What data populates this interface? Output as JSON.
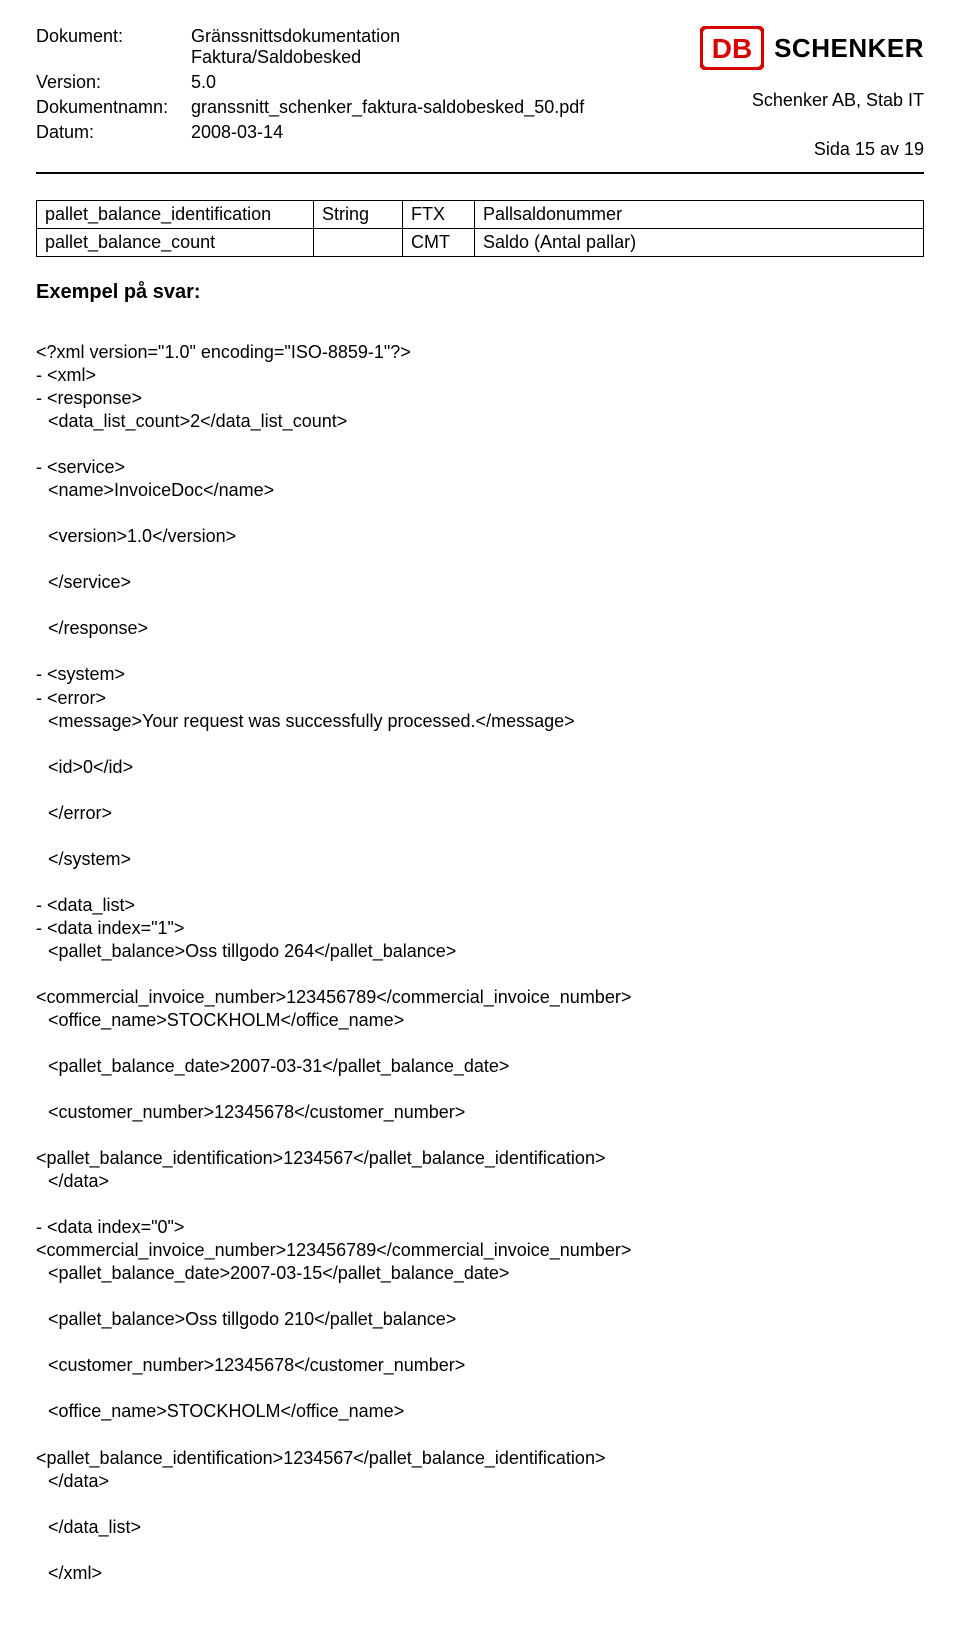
{
  "header": {
    "labels": {
      "document": "Dokument:",
      "version": "Version:",
      "docname": "Dokumentnamn:",
      "date": "Datum:"
    },
    "document_line1": "Gränssnittsdokumentation",
    "document_line2": "Faktura/Saldobesked",
    "version": "5.0",
    "docname": "granssnitt_schenker_faktura-saldobesked_50.pdf",
    "date": "2008-03-14",
    "company": "Schenker AB, Stab IT",
    "page": "Sida 15 av 19",
    "logo_text": "SCHENKER",
    "logo_db": "DB"
  },
  "table": {
    "rows": [
      {
        "c1": "pallet_balance_identification",
        "c2": "String",
        "c3": "FTX",
        "c4": "Pallsaldonummer"
      },
      {
        "c1": "pallet_balance_count",
        "c2": "",
        "c3": "CMT",
        "c4": "Saldo (Antal pallar)"
      }
    ]
  },
  "section_title": "Exempel på svar:",
  "code": {
    "l01": "<?xml version=\"1.0\" encoding=\"ISO-8859-1\"?>",
    "l02": "- <xml>",
    "l03": "- <response>",
    "l04": "<data_list_count>2</data_list_count>",
    "l05": "- <service>",
    "l06": "<name>InvoiceDoc</name>",
    "l07": "<version>1.0</version>",
    "l08": "</service>",
    "l09": "</response>",
    "l10": "- <system>",
    "l11": "- <error>",
    "l12": "<message>Your request was successfully processed.</message>",
    "l13": "<id>0</id>",
    "l14": "</error>",
    "l15": "</system>",
    "l16": "- <data_list>",
    "l17": "- <data index=\"1\">",
    "l18": "<pallet_balance>Oss tillgodo 264</pallet_balance>",
    "l19": "<commercial_invoice_number>123456789</commercial_invoice_number>",
    "l20": "<office_name>STOCKHOLM</office_name>",
    "l21": "<pallet_balance_date>2007-03-31</pallet_balance_date>",
    "l22": "<customer_number>12345678</customer_number>",
    "l23": "<pallet_balance_identification>1234567</pallet_balance_identification>",
    "l24": "</data>",
    "l25": "- <data index=\"0\">",
    "l26": "<commercial_invoice_number>123456789</commercial_invoice_number>",
    "l27": "<pallet_balance_date>2007-03-15</pallet_balance_date>",
    "l28": "<pallet_balance>Oss tillgodo 210</pallet_balance>",
    "l29": "<customer_number>12345678</customer_number>",
    "l30": "<office_name>STOCKHOLM</office_name>",
    "l31": "<pallet_balance_identification>1234567</pallet_balance_identification>",
    "l32": "</data>",
    "l33": "</data_list>",
    "l34": "</xml>"
  }
}
